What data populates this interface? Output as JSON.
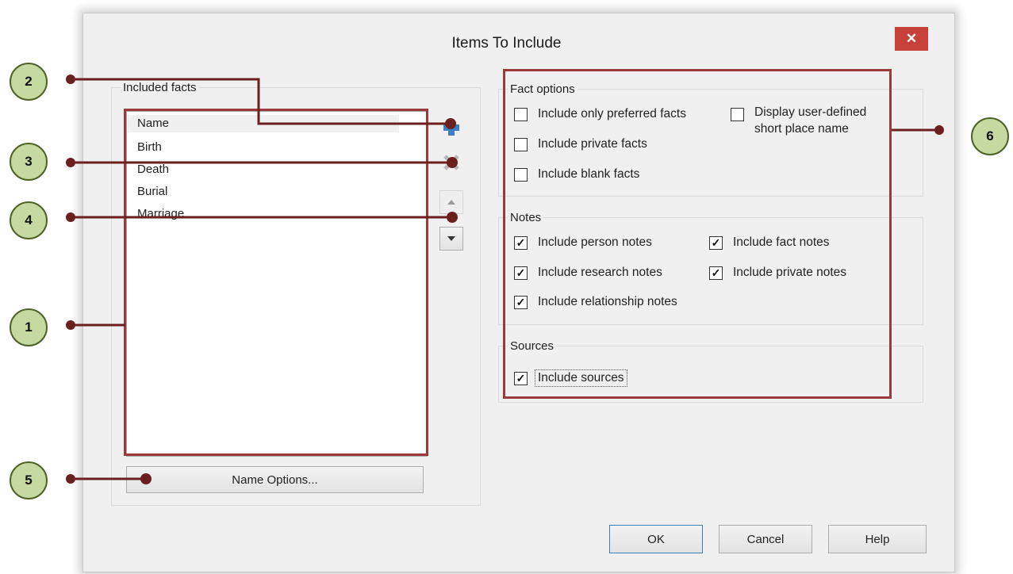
{
  "window": {
    "title": "Items To Include",
    "close_glyph": "✕"
  },
  "facts": {
    "group_label": "Included facts",
    "items": [
      "Name",
      "Birth",
      "Death",
      "Burial",
      "Marriage"
    ],
    "name_options_button": "Name Options..."
  },
  "fact_options": {
    "group_label": "Fact options",
    "only_preferred": {
      "label": "Include only preferred facts",
      "checked": false
    },
    "private_facts": {
      "label": "Include private facts",
      "checked": false
    },
    "blank_facts": {
      "label": "Include blank facts",
      "checked": false
    },
    "short_place": {
      "label_line1": "Display user-defined",
      "label_line2": "short place name",
      "checked": false
    }
  },
  "notes": {
    "group_label": "Notes",
    "person": {
      "label": "Include person notes",
      "checked": true
    },
    "fact": {
      "label": "Include fact notes",
      "checked": true
    },
    "research": {
      "label": "Include research notes",
      "checked": true
    },
    "private": {
      "label": "Include private notes",
      "checked": true
    },
    "relationship": {
      "label": "Include relationship notes",
      "checked": true
    }
  },
  "sources": {
    "group_label": "Sources",
    "include_sources": {
      "label": "Include sources",
      "checked": true
    }
  },
  "buttons": {
    "ok": "OK",
    "cancel": "Cancel",
    "help": "Help"
  },
  "callouts": [
    "1",
    "2",
    "3",
    "4",
    "5",
    "6"
  ],
  "colors": {
    "callout_fill": "#c6d9a0",
    "callout_line": "#6b1f1f",
    "highlight_box": "#9b3a3a",
    "close_button": "#c7403a"
  },
  "icons": {
    "add": "plus-icon",
    "remove": "remove-x-icon",
    "up": "arrow-up-icon",
    "down": "arrow-down-icon"
  }
}
